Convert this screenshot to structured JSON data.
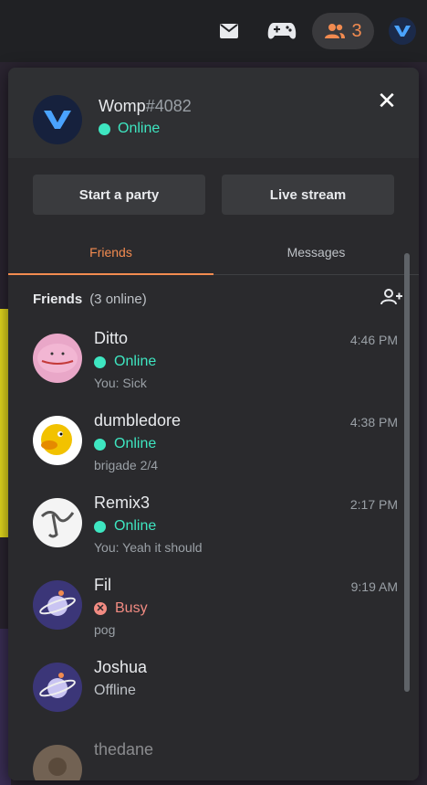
{
  "topbar": {
    "mail_icon": "mail-icon",
    "gamepad_icon": "gamepad-icon",
    "friends_count": "3",
    "colors": {
      "accent": "#f28b50"
    }
  },
  "profile": {
    "username": "Womp",
    "tag": "#4082",
    "status": "Online"
  },
  "actions": {
    "start_party": "Start a party",
    "live_stream": "Live stream"
  },
  "tabs": [
    {
      "label": "Friends",
      "active": true
    },
    {
      "label": "Messages",
      "active": false
    }
  ],
  "friends_section": {
    "title": "Friends",
    "count": "(3 online)"
  },
  "friends": [
    {
      "name": "Ditto",
      "status": "Online",
      "time": "4:46 PM",
      "sub": "You: Sick"
    },
    {
      "name": "dumbledore",
      "status": "Online",
      "time": "4:38 PM",
      "sub": "brigade 2/4"
    },
    {
      "name": "Remix3",
      "status": "Online",
      "time": "2:17 PM",
      "sub": "You: Yeah it should"
    },
    {
      "name": "Fil",
      "status": "Busy",
      "time": "9:19 AM",
      "sub": "pog"
    },
    {
      "name": "Joshua",
      "status": "Offline",
      "time": "",
      "sub": ""
    },
    {
      "name": "thedane",
      "status": "",
      "time": "",
      "sub": ""
    }
  ],
  "colors": {
    "online": "#3ee6c1",
    "busy": "#f28b82",
    "accent": "#f28b50"
  }
}
